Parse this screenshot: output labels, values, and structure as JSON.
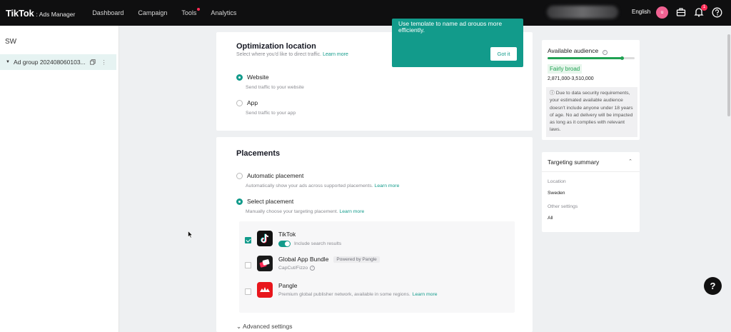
{
  "topbar": {
    "brand": "TikTok",
    "brand_sub": ": Ads Manager",
    "nav": [
      "Dashboard",
      "Campaign",
      "Tools",
      "Analytics"
    ],
    "language": "English",
    "avatar_letter": "u",
    "notification_count": "1",
    "icons": [
      "briefcase-icon",
      "bell-icon",
      "help-icon"
    ]
  },
  "sidebar": {
    "title": "SW",
    "item_label": "Ad group 202408060103..."
  },
  "tooltip": {
    "text_partial": "Use template to name ad groups more",
    "text_line2": "efficiently.",
    "button": "Got it"
  },
  "optimization": {
    "title": "Optimization location",
    "subtitle": "Select where you'd like to direct traffic.",
    "learn_more": "Learn more",
    "options": [
      {
        "label": "Website",
        "desc": "Send traffic to your website",
        "selected": true
      },
      {
        "label": "App",
        "desc": "Send traffic to your app",
        "selected": false
      }
    ]
  },
  "placements": {
    "title": "Placements",
    "automatic": {
      "label": "Automatic placement",
      "desc": "Automatically show your ads across supported placements.",
      "learn_more": "Learn more"
    },
    "select": {
      "label": "Select placement",
      "desc": "Manually choose your targeting placement.",
      "learn_more": "Learn more"
    },
    "items": [
      {
        "name": "TikTok",
        "sub": "Include search results",
        "checked": true
      },
      {
        "name": "Global App Bundle",
        "tag": "Powered by Pangle",
        "sub": "CapCut/Fizzo",
        "checked": false
      },
      {
        "name": "Pangle",
        "sub": "Premium global publisher network, available in some regions.",
        "learn_more": "Learn more",
        "checked": false
      }
    ],
    "advanced": "Advanced settings"
  },
  "audience": {
    "title": "Available audience",
    "level": 0.85,
    "status": "Fairly broad",
    "range": "2,871,000-3,510,000",
    "notice": "Due to data security requirements, your estimated available audience doesn't include anyone under 18 years of age. No ad delivery will be impacted as long as it complies with relevant laws."
  },
  "targeting": {
    "title": "Targeting summary",
    "location_label": "Location",
    "location_value": "Sweden",
    "other_label": "Other settings",
    "other_value": "All"
  },
  "colors": {
    "accent": "#129b8b",
    "topbar": "#0f0f10",
    "audience_green": "#1fa152"
  }
}
